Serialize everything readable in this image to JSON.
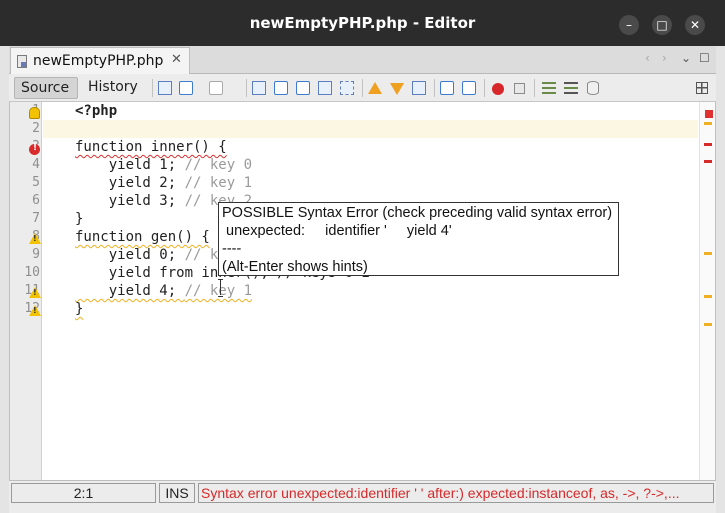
{
  "window": {
    "title": "newEmptyPHP.php - Editor",
    "controls": [
      "minimize-icon",
      "maximize-icon",
      "close-icon"
    ]
  },
  "tabs": [
    {
      "label": "newEmptyPHP.php",
      "icon": "php-file-icon",
      "close": "✕"
    }
  ],
  "tab_nav": {
    "prev": "‹",
    "next": "›",
    "list": "⌄",
    "restore": "☐"
  },
  "toolbar": {
    "source_label": "Source",
    "history_label": "History"
  },
  "editor": {
    "line_numbers": [
      "1",
      "2",
      "3",
      "4",
      "5",
      "6",
      "7",
      "8",
      "9",
      "10",
      "11",
      "12"
    ],
    "gutter_markers": {
      "1": "hint-icon",
      "3": "error-icon",
      "8": "warning-icon",
      "11": "warning-icon",
      "12": "warning-icon"
    },
    "lines": [
      {
        "code": "<?php"
      },
      {
        "code": ""
      },
      {
        "code": "function inner() {"
      },
      {
        "code": "    yield 1; ",
        "comment": "// key 0"
      },
      {
        "code": "    yield 2; ",
        "comment": "// key 1"
      },
      {
        "code": "    yield 3; ",
        "comment": "// key 2"
      },
      {
        "code": "}"
      },
      {
        "code": "function gen() {"
      },
      {
        "code": "    yield 0; ",
        "comment": "// key 0"
      },
      {
        "code": "    yield from inner(); // keys 0-2"
      },
      {
        "code": "    yield 4; ",
        "comment": "// key 1"
      },
      {
        "code": "}"
      }
    ]
  },
  "tooltip": {
    "line1": "POSSIBLE Syntax Error (check preceding valid syntax error)",
    "line2": " unexpected:     identifier '     yield 4'",
    "line3": "----",
    "line4": "(Alt-Enter shows hints)"
  },
  "statusbar": {
    "position": "2:1",
    "mode": "INS",
    "message": "Syntax error  unexpected:identifier ' '  after:)  expected:instanceof, as, ->, ?->,..."
  },
  "colors": {
    "error": "#d62a2a",
    "warning": "#f0b020",
    "current_line": "#fbf7e2",
    "comment": "#9a9a9a"
  }
}
